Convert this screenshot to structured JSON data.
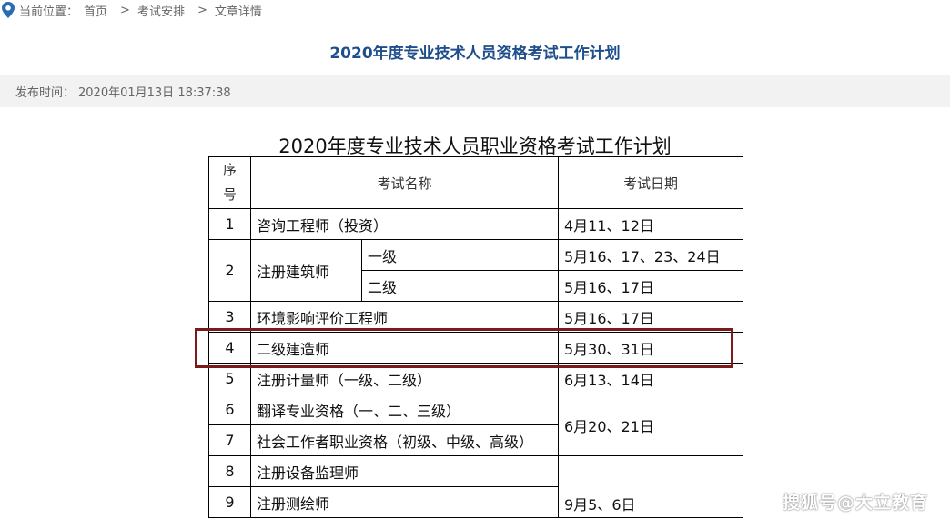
{
  "breadcrumb": {
    "prefix": "当前位置：",
    "items": [
      "首页",
      "考试安排",
      "文章详情"
    ],
    "separator": ">"
  },
  "article": {
    "title": "2020年度专业技术人员资格考试工作计划",
    "publish_label": "发布时间：",
    "publish_time": "2020年01月13日 18:37:38"
  },
  "table": {
    "caption": "2020年度专业技术人员职业资格考试工作计划",
    "headers": {
      "index": "序号",
      "name": "考试名称",
      "date": "考试日期"
    },
    "rows": [
      {
        "index": "1",
        "name": "咨询工程师（投资）",
        "date": "4月11、12日"
      },
      {
        "index": "2",
        "name": "注册建筑师",
        "sub": [
          {
            "level": "一级",
            "date": "5月16、17、23、24日"
          },
          {
            "level": "二级",
            "date": "5月16、17日"
          }
        ]
      },
      {
        "index": "3",
        "name": "环境影响评价工程师",
        "date": "5月16、17日"
      },
      {
        "index": "4",
        "name": "二级建造师",
        "date": "5月30、31日"
      },
      {
        "index": "5",
        "name": "注册计量师（一级、二级）",
        "date": "6月13、14日"
      },
      {
        "index": "6",
        "name": "翻译专业资格（一、二、三级）",
        "date": "6月20、21日"
      },
      {
        "index": "7",
        "name": "社会工作者职业资格（初级、中级、高级）"
      },
      {
        "index": "8",
        "name": "注册设备监理师"
      },
      {
        "index": "9",
        "name": "注册测绘师",
        "date": "9月5、6日"
      }
    ]
  },
  "watermark": "搜狐号@大立教育",
  "colors": {
    "title": "#1f4e8c",
    "highlight": "#7a1a1a",
    "meta_bg": "#f2f2f2"
  }
}
